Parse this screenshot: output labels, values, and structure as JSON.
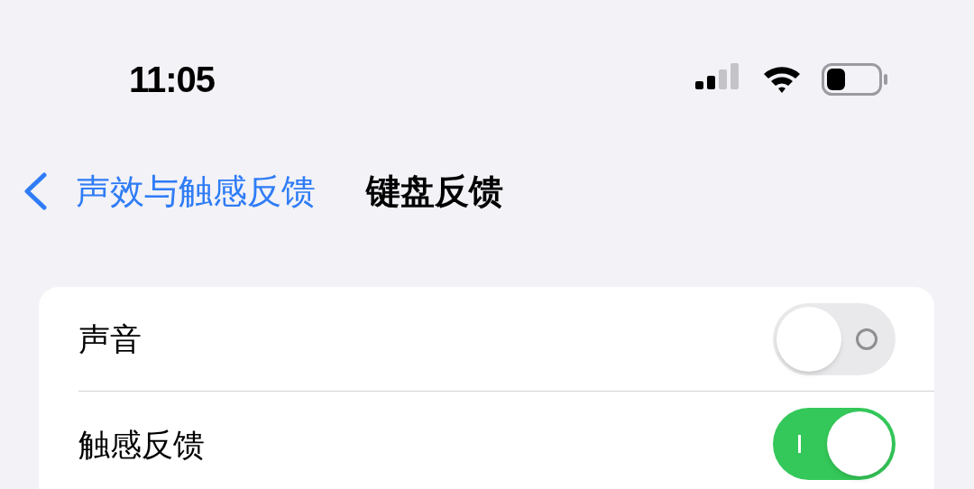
{
  "status_bar": {
    "time": "11:05"
  },
  "nav": {
    "back_label": "声效与触感反馈",
    "title": "键盘反馈"
  },
  "settings": [
    {
      "label": "声音",
      "on": false
    },
    {
      "label": "触感反馈",
      "on": true
    }
  ]
}
